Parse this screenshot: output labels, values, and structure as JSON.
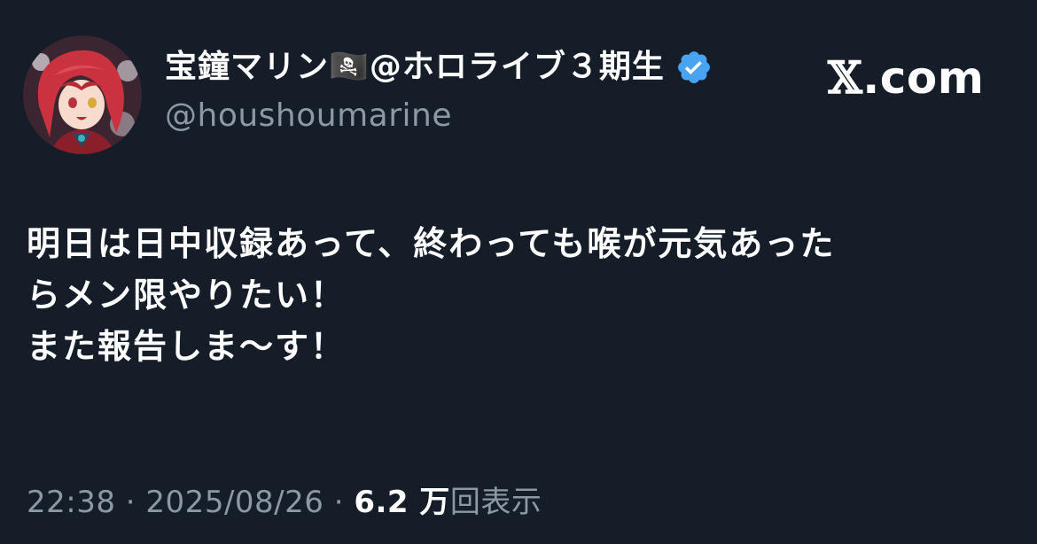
{
  "author": {
    "display_name": "宝鐘マリン🏴‍☠️@ホロライブ３期生",
    "handle": "@houshoumarine",
    "verified": true,
    "verified_color": "#4aa3f0"
  },
  "site_logo": {
    "x_glyph": "𝕏",
    "suffix": ".com"
  },
  "tweet": {
    "lines": [
      "明日は日中収録あって、終わっても喉が元気あった",
      "らメン限やりたい！",
      "また報告しま〜す！"
    ]
  },
  "meta": {
    "time": "22:38",
    "separator": "·",
    "date": "2025/08/26",
    "views_count": "6.2 万",
    "views_label": "回表示"
  },
  "colors": {
    "background": "#151d28",
    "text": "#ffffff",
    "secondary": "#8b98a5"
  }
}
